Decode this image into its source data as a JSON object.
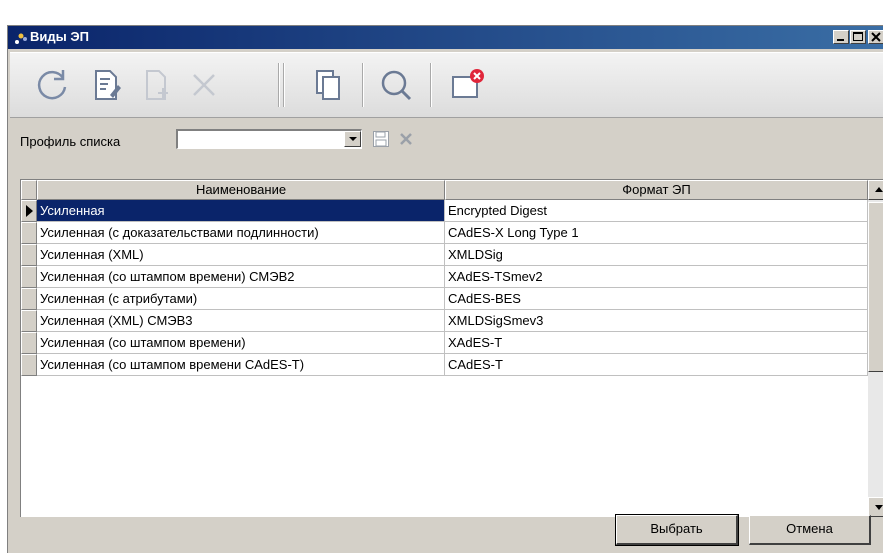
{
  "window": {
    "title": "Виды ЭП",
    "icon": "app-icon"
  },
  "toolbar": {
    "buttons": [
      {
        "name": "refresh-icon",
        "enabled": true
      },
      {
        "name": "edit-icon",
        "enabled": true
      },
      {
        "name": "new-document-icon",
        "enabled": false
      },
      {
        "name": "delete-icon",
        "enabled": false
      },
      {
        "name": "copy-icon",
        "enabled": true
      },
      {
        "name": "search-icon",
        "enabled": true
      },
      {
        "name": "close-window-icon",
        "enabled": true
      }
    ]
  },
  "profile": {
    "label": "Профиль списка",
    "value": "",
    "save_icon": "save-icon",
    "clear_icon": "clear-icon"
  },
  "table": {
    "columns": [
      "Наименование",
      "Формат ЭП"
    ],
    "rows": [
      {
        "name": "Усиленная",
        "format": "Encrypted Digest",
        "selected": true
      },
      {
        "name": "Усиленная (с доказательствами подлинности)",
        "format": "CAdES-X Long Type 1",
        "selected": false
      },
      {
        "name": "Усиленная (XML)",
        "format": "XMLDSig",
        "selected": false
      },
      {
        "name": "Усиленная (со штампом времени) СМЭВ2",
        "format": "XAdES-TSmev2",
        "selected": false
      },
      {
        "name": "Усиленная (с атрибутами)",
        "format": "CAdES-BES",
        "selected": false
      },
      {
        "name": "Усиленная (XML) СМЭВ3",
        "format": "XMLDSigSmev3",
        "selected": false
      },
      {
        "name": "Усиленная (со штампом времени)",
        "format": "XAdES-T",
        "selected": false
      },
      {
        "name": "Усиленная (со штампом времени CAdES-T)",
        "format": "CAdES-T",
        "selected": false
      }
    ]
  },
  "footer": {
    "select_label": "Выбрать",
    "cancel_label": "Отмена"
  },
  "colors": {
    "title_bar": "#0a246a",
    "selection": "#0a246a",
    "delete_badge": "#e0263a"
  }
}
